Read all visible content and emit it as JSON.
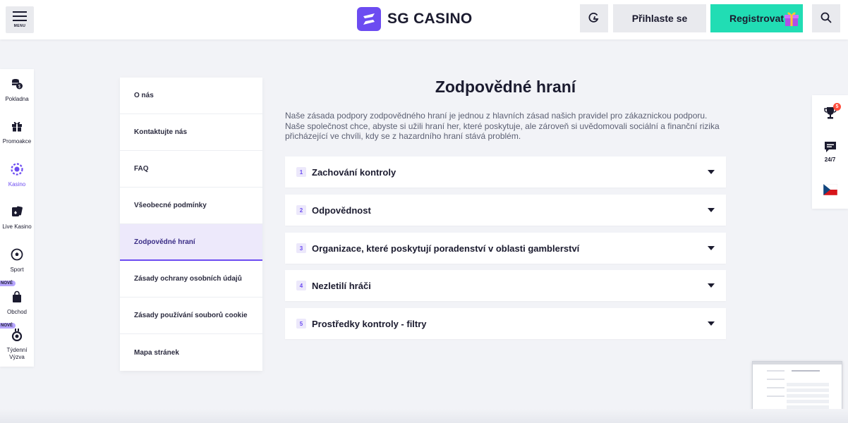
{
  "header": {
    "menu_label": "MENU",
    "logo_text": "SG CASINO",
    "login_label": "Přihlaste se",
    "register_label": "Registrovat"
  },
  "leftnav": {
    "items": [
      {
        "label": "Pokladna",
        "icon": "coins-icon"
      },
      {
        "label": "Promoakce",
        "icon": "gift-icon"
      },
      {
        "label": "Kasino",
        "icon": "casino-chip-icon"
      },
      {
        "label": "Live Kasino",
        "icon": "cards-icon"
      },
      {
        "label": "Sport",
        "icon": "soccer-ball-icon"
      },
      {
        "label": "Obchod",
        "icon": "shopping-bag-icon"
      },
      {
        "label": "Týdenní Výzva",
        "icon": "medal-icon"
      }
    ],
    "new_badge": "NOVÉ"
  },
  "sidemenu": {
    "items": [
      "O nás",
      "Kontaktujte nás",
      "FAQ",
      "Všeobecné podmínky",
      "Zodpovědné hraní",
      "Zásady ochrany osobních údajů",
      "Zásady používání souborů cookie",
      "Mapa stránek"
    ],
    "active": "Zodpovědné hraní"
  },
  "main": {
    "title": "Zodpovědné hraní",
    "intro": "Naše zásada podpory zodpovědného hraní je jednou z hlavních zásad našich pravidel pro zákaznickou podporu. Naše společnost chce, abyste si užili hraní her, které poskytuje, ale zároveň si uvědomovali sociální a finanční rizika přicházející ve chvíli, kdy se z hazardního hraní stává problém.",
    "sections": [
      {
        "num": "1",
        "title": "Zachování kontroly"
      },
      {
        "num": "2",
        "title": "Odpovědnost"
      },
      {
        "num": "3",
        "title": "Organizace, které poskytují poradenství v oblasti gamblerství"
      },
      {
        "num": "4",
        "title": "Nezletilí hráči"
      },
      {
        "num": "5",
        "title": "Prostředky kontroly - filtry"
      }
    ]
  },
  "rightpanel": {
    "trophy_badge": "5",
    "chat_label": "24/7",
    "language": "CZ"
  },
  "colors": {
    "accent": "#6c4cf1",
    "register": "#21ddb4",
    "background": "#f2f3f7"
  }
}
